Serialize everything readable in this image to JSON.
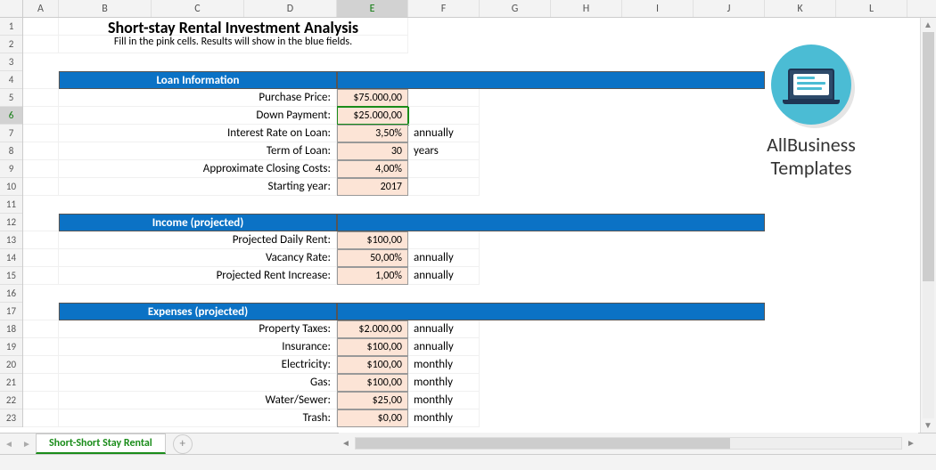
{
  "columns": [
    {
      "key": "A",
      "w": 40
    },
    {
      "key": "B",
      "w": 104
    },
    {
      "key": "C",
      "w": 104
    },
    {
      "key": "D",
      "w": 104
    },
    {
      "key": "E",
      "w": 80,
      "sel": true
    },
    {
      "key": "F",
      "w": 80
    },
    {
      "key": "G",
      "w": 80
    },
    {
      "key": "H",
      "w": 80
    },
    {
      "key": "I",
      "w": 80
    },
    {
      "key": "J",
      "w": 80
    },
    {
      "key": "K",
      "w": 80
    },
    {
      "key": "L",
      "w": 80
    }
  ],
  "rows": [
    1,
    2,
    3,
    4,
    5,
    6,
    7,
    8,
    9,
    10,
    11,
    12,
    13,
    14,
    15,
    16,
    17,
    18,
    19,
    20,
    21,
    22,
    23
  ],
  "selected_row": 6,
  "title": "Short-stay Rental Investment Analysis",
  "subtitle": "Fill in the  pink cells. Results will show in the blue fields.",
  "sections": {
    "loan": {
      "header": "Loan Information",
      "rows": [
        {
          "label": "Purchase Price:",
          "value": "$75.000,00",
          "unit": ""
        },
        {
          "label": "Down Payment:",
          "value": "$25.000,00",
          "unit": "",
          "selected": true
        },
        {
          "label": "Interest Rate on Loan:",
          "value": "3,50%",
          "unit": "annually"
        },
        {
          "label": "Term of Loan:",
          "value": "30",
          "unit": "years"
        },
        {
          "label": "Approximate Closing Costs:",
          "value": "4,00%",
          "unit": ""
        },
        {
          "label": "Starting year:",
          "value": "2017",
          "unit": ""
        }
      ]
    },
    "income": {
      "header": "Income (projected)",
      "rows": [
        {
          "label": "Projected Daily Rent:",
          "value": "$100,00",
          "unit": ""
        },
        {
          "label": "Vacancy Rate:",
          "value": "50,00%",
          "unit": "annually"
        },
        {
          "label": "Projected Rent Increase:",
          "value": "1,00%",
          "unit": "annually"
        }
      ]
    },
    "expenses": {
      "header": "Expenses (projected)",
      "rows": [
        {
          "label": "Property Taxes:",
          "value": "$2.000,00",
          "unit": "annually"
        },
        {
          "label": "Insurance:",
          "value": "$100,00",
          "unit": "annually"
        },
        {
          "label": "Electricity:",
          "value": "$100,00",
          "unit": "monthly"
        },
        {
          "label": "Gas:",
          "value": "$100,00",
          "unit": "monthly"
        },
        {
          "label": "Water/Sewer:",
          "value": "$25,00",
          "unit": "monthly"
        },
        {
          "label": "Trash:",
          "value": "$0,00",
          "unit": "monthly"
        }
      ]
    }
  },
  "logo": {
    "line1": "AllBusiness",
    "line2": "Templates"
  },
  "sheet_tab": "Short-Short Stay Rental"
}
